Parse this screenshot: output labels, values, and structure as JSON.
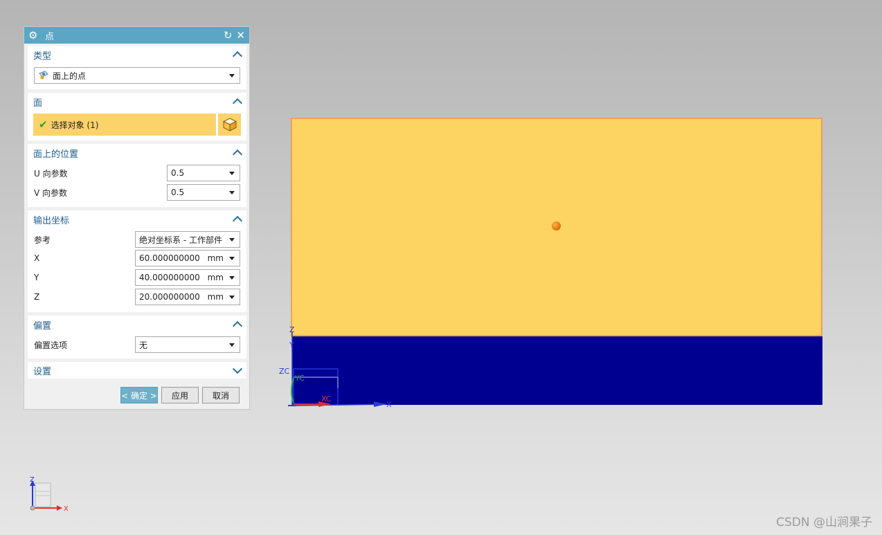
{
  "dialog": {
    "title": "点",
    "groups": {
      "type": {
        "header": "类型",
        "selected": "面上的点"
      },
      "face": {
        "header": "面",
        "select_label": "选择对象 (1)"
      },
      "position": {
        "header": "面上的位置",
        "u_label": "U 向参数",
        "u_value": "0.5",
        "v_label": "V 向参数",
        "v_value": "0.5"
      },
      "output": {
        "header": "输出坐标",
        "ref_label": "参考",
        "ref_value": "绝对坐标系 - 工作部件",
        "x_label": "X",
        "x_value": "60.000000000",
        "y_label": "Y",
        "y_value": "40.000000000",
        "z_label": "Z",
        "z_value": "20.000000000",
        "unit": "mm"
      },
      "offset": {
        "header": "偏置",
        "option_label": "偏置选项",
        "option_value": "无"
      },
      "settings": {
        "header": "设置"
      }
    },
    "buttons": {
      "ok": "< 确定 >",
      "apply": "应用",
      "cancel": "取消"
    }
  },
  "viewport": {
    "wcs_labels": {
      "zc": "ZC",
      "yc": "YC",
      "xc": "XC"
    },
    "abs_labels": {
      "z": "Z",
      "y": "Y",
      "x": "X"
    },
    "triad_labels": {
      "z": "Z",
      "x": "X"
    },
    "colors": {
      "face_fill": "#fdd462",
      "face_edge": "#f0a050",
      "body_dark": "#000090",
      "point": "#e06a00"
    }
  },
  "watermark": "CSDN @山涧果子"
}
